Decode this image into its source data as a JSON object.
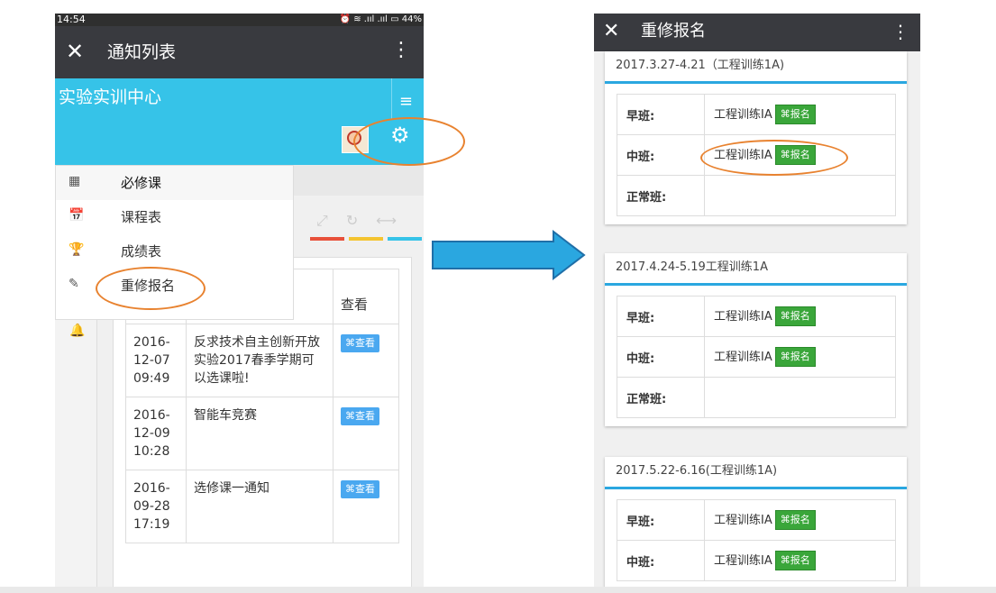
{
  "left_phone": {
    "status": {
      "time": "14:54",
      "right": "⏰ ≋ .ııl .ııl ▭ 44%"
    },
    "header": {
      "close": "✕",
      "title": "通知列表",
      "more": "⋮"
    },
    "site": {
      "name": "实验实训中心",
      "menu_icon": "≡"
    },
    "menu": [
      {
        "icon": "▦",
        "label": "必修课"
      },
      {
        "icon": "📅",
        "label": "课程表"
      },
      {
        "icon": "🏆",
        "label": "成绩表"
      },
      {
        "icon": "✎",
        "label": "重修报名"
      }
    ],
    "bell_icon": "🔔",
    "table": {
      "header_view": "查看",
      "rows": [
        {
          "date": "2016-\n12-07\n09:49",
          "title": "反求技术自主创新开放实验2017春季学期可以选课啦!",
          "btn": "⌘查看",
          "link": true
        },
        {
          "date": "2016-\n12-09\n10:28",
          "title": "智能车竞赛",
          "btn": "⌘查看",
          "link": false
        },
        {
          "date": "2016-\n09-28\n17:19",
          "title": "选修课一通知",
          "btn": "⌘查看",
          "link": false
        }
      ]
    }
  },
  "right_phone": {
    "header": {
      "close": "✕",
      "title": "重修报名",
      "more": "⋮"
    },
    "panels": [
      {
        "title": "2017.3.27-4.21（工程训练1A)",
        "rows": [
          {
            "label": "早班:",
            "course": "工程训练IA",
            "btn": "⌘报名"
          },
          {
            "label": "中班:",
            "course": "工程训练IA",
            "btn": "⌘报名"
          },
          {
            "label": "正常班:",
            "course": "",
            "btn": ""
          }
        ]
      },
      {
        "title": "2017.4.24-5.19工程训练1A",
        "rows": [
          {
            "label": "早班:",
            "course": "工程训练IA",
            "btn": "⌘报名"
          },
          {
            "label": "中班:",
            "course": "工程训练IA",
            "btn": "⌘报名"
          },
          {
            "label": "正常班:",
            "course": "",
            "btn": ""
          }
        ]
      },
      {
        "title": "2017.5.22-6.16(工程训练1A)",
        "rows": [
          {
            "label": "早班:",
            "course": "工程训练IA",
            "btn": "⌘报名"
          },
          {
            "label": "中班:",
            "course": "工程训练IA",
            "btn": "⌘报名"
          }
        ]
      }
    ]
  },
  "colors": {
    "accent_cyan": "#36c3e8",
    "callout": "#e8822f",
    "arrow": "#2aa7e0",
    "enroll_green": "#3aa63a"
  }
}
